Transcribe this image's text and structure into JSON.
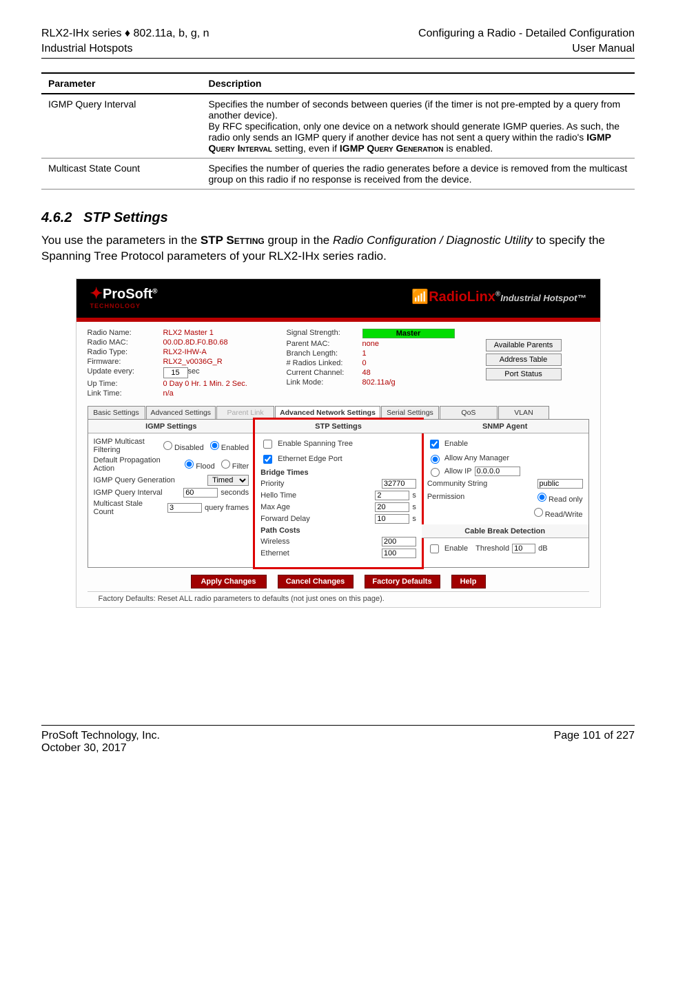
{
  "header": {
    "left_line1": "RLX2-IHx series ♦ 802.11a, b, g, n",
    "left_line2": "Industrial Hotspots",
    "right_line1": "Configuring a Radio - Detailed Configuration",
    "right_line2": "User Manual"
  },
  "table": {
    "col1": "Parameter",
    "col2": "Description",
    "rows": [
      {
        "param": "IGMP Query Interval",
        "desc1": "Specifies the number of seconds between queries (if the timer is not pre-empted by a query from another device).",
        "desc2a": "By RFC specification, only one device on a network should generate IGMP queries. As such, the radio only sends an IGMP query if another device has not sent a query within the radio's ",
        "desc2b": "IGMP Query Interval",
        "desc2c": " setting, even if ",
        "desc2d": "IGMP Query Generation",
        "desc2e": " is enabled."
      },
      {
        "param": "Multicast State Count",
        "desc1": "Specifies the number of queries the radio generates before a device is removed from the multicast group on this radio if no response is received from the device."
      }
    ]
  },
  "section": {
    "number": "4.6.2",
    "title": "STP Settings",
    "body_a": "You use the parameters in the ",
    "body_b": "STP Setting",
    "body_c": " group in the ",
    "body_d": "Radio Configuration / Diagnostic Utility",
    "body_e": " to specify the Spanning Tree Protocol parameters of your RLX2-IHx series radio."
  },
  "ui": {
    "prosoft": "ProSoft",
    "prosoft_sub": "TECHNOLOGY",
    "radiolinx": "RadioLinx",
    "radiolinx_tag": "Industrial Hotspot™",
    "status_left": {
      "radio_name_l": "Radio Name:",
      "radio_name_v": "RLX2 Master 1",
      "radio_mac_l": "Radio MAC:",
      "radio_mac_v": "00.0D.8D.F0.B0.68",
      "radio_type_l": "Radio Type:",
      "radio_type_v": "RLX2-IHW-A",
      "firmware_l": "Firmware:",
      "firmware_v": "RLX2_v0036G_R",
      "update_l": "Update every:",
      "update_v": "15",
      "update_unit": "sec",
      "uptime_l": "Up Time:",
      "uptime_v": "0 Day 0 Hr. 1 Min. 2 Sec.",
      "linktime_l": "Link Time:",
      "linktime_v": "n/a"
    },
    "status_mid": {
      "signal_l": "Signal Strength:",
      "signal_v": "Master",
      "parent_l": "Parent MAC:",
      "parent_v": "none",
      "branch_l": "Branch Length:",
      "branch_v": "1",
      "linked_l": "# Radios Linked:",
      "linked_v": "0",
      "channel_l": "Current Channel:",
      "channel_v": "48",
      "mode_l": "Link Mode:",
      "mode_v": "802.11a/g"
    },
    "buttons_right": {
      "b1": "Available Parents",
      "b2": "Address Table",
      "b3": "Port Status"
    },
    "tabs": [
      "Basic Settings",
      "Advanced Settings",
      "Parent Link",
      "Advanced Network Settings",
      "Serial Settings",
      "QoS",
      "VLAN"
    ],
    "igmp": {
      "title": "IGMP Settings",
      "filter_l": "IGMP Multicast Filtering",
      "opt_disabled": "Disabled",
      "opt_enabled": "Enabled",
      "prop_l": "Default Propagation Action",
      "opt_flood": "Flood",
      "opt_filter": "Filter",
      "gen_l": "IGMP Query Generation",
      "gen_v": "Timed Interval",
      "int_l": "IGMP Query Interval",
      "int_v": "60",
      "int_u": "seconds",
      "stale_l": "Multicast Stale Count",
      "stale_v": "3",
      "stale_u": "query frames"
    },
    "stp": {
      "title": "STP Settings",
      "enable_span": "Enable Spanning Tree",
      "edge": "Ethernet Edge Port",
      "bridge": "Bridge Times",
      "prio_l": "Priority",
      "prio_v": "32770",
      "hello_l": "Hello Time",
      "hello_v": "2",
      "unit": "s",
      "max_l": "Max Age",
      "max_v": "20",
      "fwd_l": "Forward Delay",
      "fwd_v": "10",
      "path": "Path Costs",
      "wire_l": "Wireless",
      "wire_v": "200",
      "eth_l": "Ethernet",
      "eth_v": "100"
    },
    "snmp": {
      "title": "SNMP Agent",
      "enable": "Enable",
      "any": "Allow Any Manager",
      "allow_ip": "Allow IP",
      "allow_ip_v": "0.0.0.0",
      "comm_l": "Community String",
      "comm_v": "public",
      "perm_l": "Permission",
      "ro": "Read only",
      "rw": "Read/Write",
      "cable_title": "Cable Break Detection",
      "cable_en": "Enable",
      "thresh_l": "Threshold",
      "thresh_v": "10",
      "thresh_u": "dB"
    },
    "actions": {
      "apply": "Apply Changes",
      "cancel": "Cancel Changes",
      "factory": "Factory Defaults",
      "help": "Help"
    },
    "footer_note": "Factory Defaults: Reset ALL radio parameters to defaults (not just ones on this page)."
  },
  "footer": {
    "left_line1": "ProSoft Technology, Inc.",
    "left_line2": "October 30, 2017",
    "right": "Page 101 of 227"
  }
}
